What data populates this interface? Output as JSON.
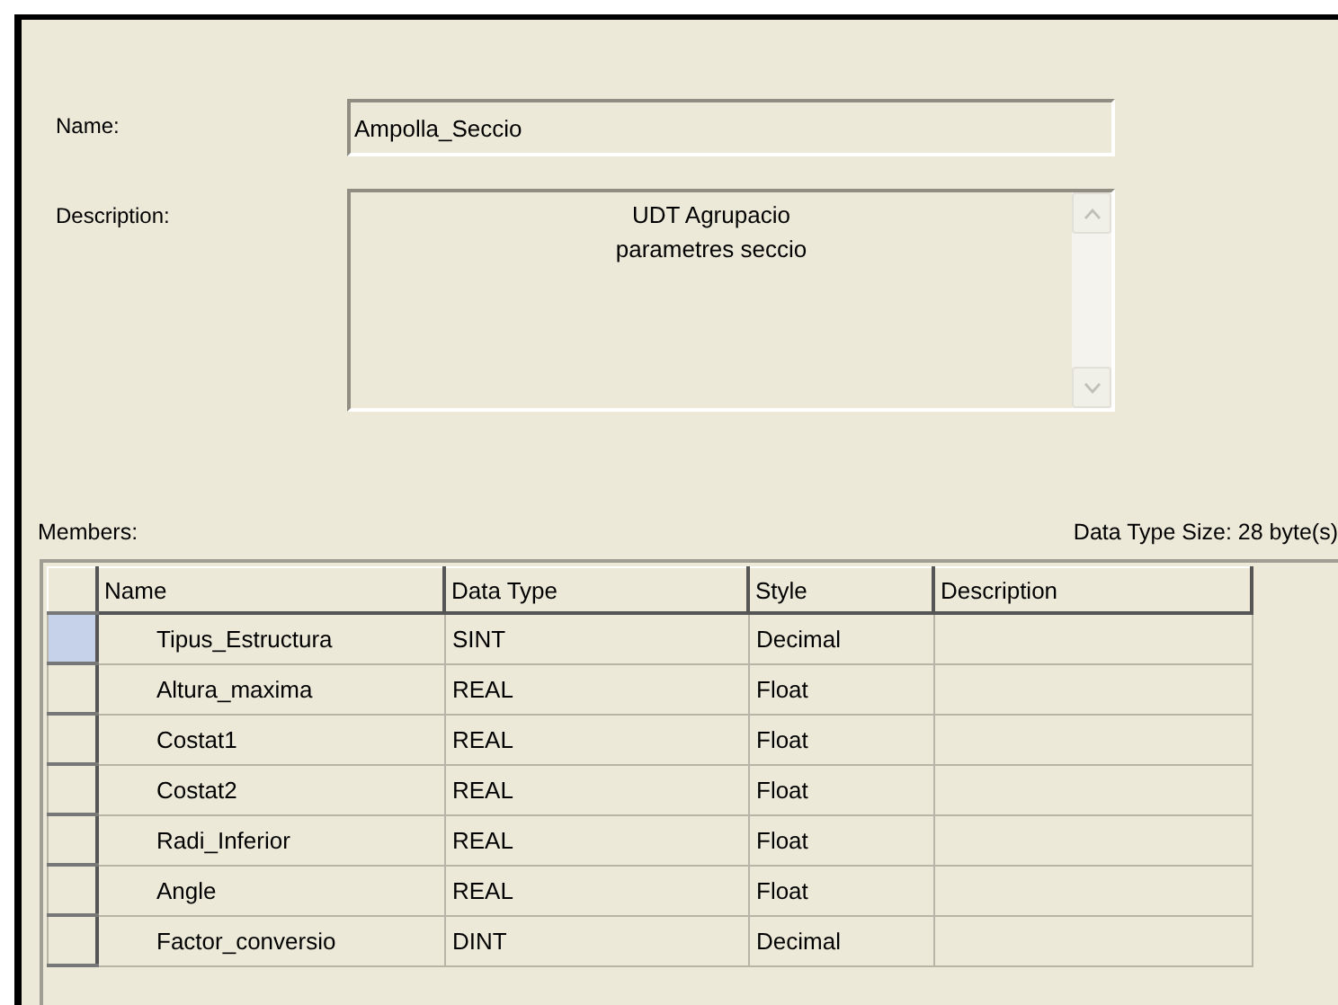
{
  "name_label": "Name:",
  "name_value": "Ampolla_Seccio",
  "description_label": "Description:",
  "description_value": "UDT Agrupacio\nparametres seccio",
  "members_label": "Members:",
  "size_text": "Data Type Size: 28 byte(s)",
  "table": {
    "columns": [
      "Name",
      "Data Type",
      "Style",
      "Description"
    ],
    "rows": [
      {
        "cells": [
          "Tipus_Estructura",
          "SINT",
          "Decimal",
          ""
        ],
        "selected": true
      },
      {
        "cells": [
          "Altura_maxima",
          "REAL",
          "Float",
          ""
        ],
        "selected": false
      },
      {
        "cells": [
          "Costat1",
          "REAL",
          "Float",
          ""
        ],
        "selected": false
      },
      {
        "cells": [
          "Costat2",
          "REAL",
          "Float",
          ""
        ],
        "selected": false
      },
      {
        "cells": [
          "Radi_Inferior",
          "REAL",
          "Float",
          ""
        ],
        "selected": false
      },
      {
        "cells": [
          "Angle",
          "REAL",
          "Float",
          ""
        ],
        "selected": false
      },
      {
        "cells": [
          "Factor_conversio",
          "DINT",
          "Decimal",
          ""
        ],
        "selected": false
      }
    ]
  }
}
